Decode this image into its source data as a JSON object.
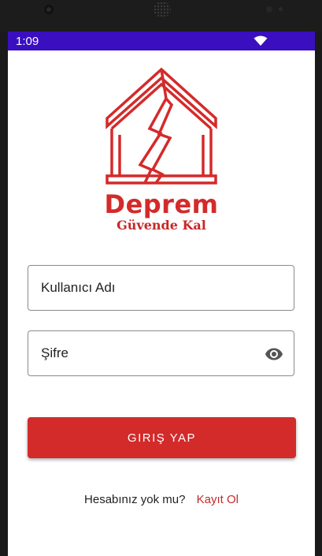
{
  "status_bar": {
    "time": "1:09",
    "wifi_icon": "wifi-icon"
  },
  "logo": {
    "title": "Deprem",
    "subtitle": "Güvende Kal",
    "icon": "cracked-house-icon",
    "color": "#d42a2a"
  },
  "login_form": {
    "username_placeholder": "Kullanıcı Adı",
    "username_value": "",
    "password_placeholder": "Şifre",
    "password_value": "",
    "password_toggle_icon": "eye-icon",
    "login_button_label": "GIRIŞ YAP"
  },
  "signup": {
    "question": "Hesabınız yok mu?",
    "link_label": "Kayıt Ol"
  },
  "colors": {
    "status_bar": "#3a0fc0",
    "accent": "#d32a2a"
  }
}
